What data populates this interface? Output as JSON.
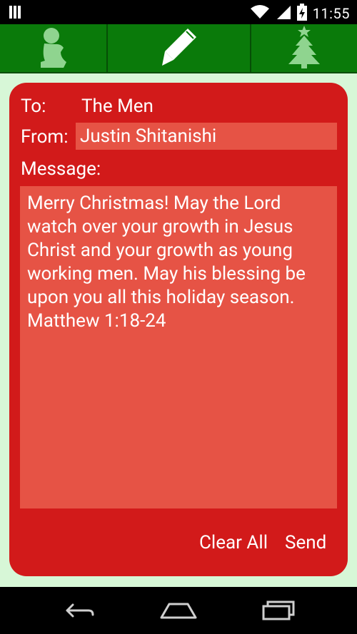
{
  "status_bar": {
    "time": "11:55",
    "icons": [
      "sim-card-icon",
      "wifi-icon",
      "signal-icon",
      "battery-charging-icon"
    ]
  },
  "tabs": [
    {
      "icon": "praying-child-icon"
    },
    {
      "icon": "pencil-icon"
    },
    {
      "icon": "christmas-tree-icon"
    }
  ],
  "form": {
    "to_label": "To:",
    "to_value": "The Men",
    "from_label": "From:",
    "from_value": "Justin Shitanishi",
    "message_label": "Message:",
    "message_value": "Merry Christmas! May the Lord watch over your growth in Jesus Christ and your growth as young working men. May his blessing be upon you all this holiday season. Matthew 1:18-24"
  },
  "actions": {
    "clear_label": "Clear All",
    "send_label": "Send"
  },
  "nav": {
    "icons": [
      "back-icon",
      "home-icon",
      "recent-apps-icon"
    ]
  },
  "colors": {
    "tab_bar": "#0a7a0a",
    "card": "#d21a1a",
    "field": "#e65345",
    "background": "#d7f7d7",
    "icon_tint": "#8fd48f"
  }
}
